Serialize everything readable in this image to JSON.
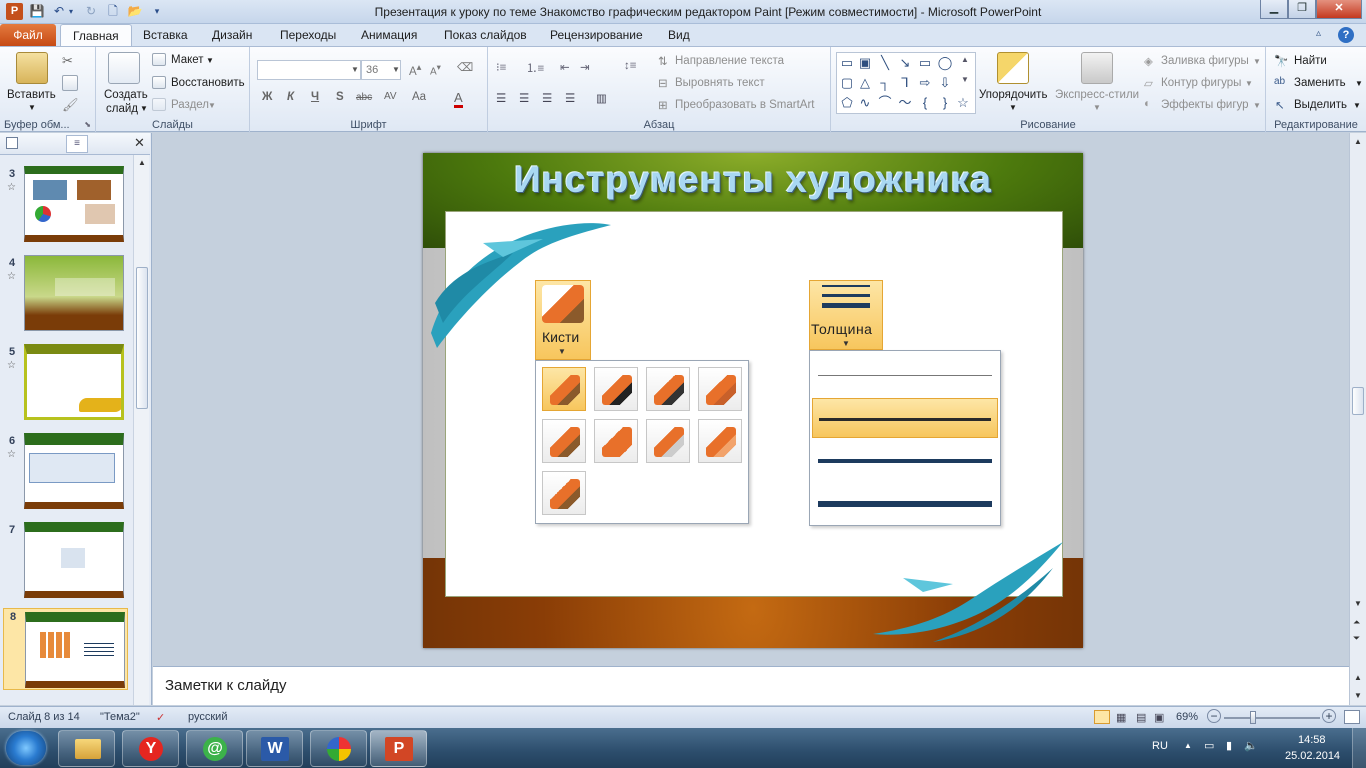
{
  "window": {
    "title": "Презентация к уроку по теме Знакомство графическим редактором Paint [Режим совместимости]  -  Microsoft PowerPoint"
  },
  "tabs": [
    "Файл",
    "Главная",
    "Вставка",
    "Дизайн",
    "Переходы",
    "Анимация",
    "Показ слайдов",
    "Рецензирование",
    "Вид"
  ],
  "ribbon": {
    "clipboard": {
      "paste": "Вставить",
      "label": "Буфер обм..."
    },
    "slides": {
      "new_slide_1": "Создать",
      "new_slide_2": "слайд",
      "layout": "Макет",
      "reset": "Восстановить",
      "section": "Раздел",
      "label": "Слайды"
    },
    "font": {
      "font_name": "",
      "font_size": "36",
      "label": "Шрифт",
      "bold": "Ж",
      "italic": "К",
      "underline": "Ч",
      "shadow": "S",
      "strike": "abc",
      "spacing": "AV",
      "case": "Aa",
      "color": "A"
    },
    "paragraph": {
      "text_direction": "Направление текста",
      "align_text": "Выровнять текст",
      "smartart": "Преобразовать в SmartArt",
      "label": "Абзац"
    },
    "drawing": {
      "arrange": "Упорядочить",
      "quick_styles": "Экспресс-стили",
      "fill": "Заливка фигуры",
      "outline": "Контур фигуры",
      "effects": "Эффекты фигур",
      "label": "Рисование"
    },
    "editing": {
      "find": "Найти",
      "replace": "Заменить",
      "select": "Выделить",
      "label": "Редактирование"
    }
  },
  "thumbnails": [
    {
      "num": "3",
      "star": "☆",
      "bg": "#2c6d1c"
    },
    {
      "num": "4",
      "star": "☆",
      "bg": "#6b9a1e"
    },
    {
      "num": "5",
      "star": "☆",
      "bg": "#7a8a12"
    },
    {
      "num": "6",
      "star": "☆",
      "bg": "#2c6d1c"
    },
    {
      "num": "7",
      "star": "",
      "bg": "#2c6d1c"
    },
    {
      "num": "8",
      "star": "",
      "bg": "#2c6d1c"
    }
  ],
  "slide": {
    "title": "Инструменты художника",
    "brushes_label": "Кисти",
    "thickness_label": "Толщина",
    "thickness_levels": [
      1,
      2,
      3,
      4
    ],
    "selected_thickness": 2,
    "brush_count": 9,
    "selected_brush": 1
  },
  "notes": {
    "placeholder": "Заметки к слайду"
  },
  "status": {
    "slide": "Слайд 8 из 14",
    "theme": "\"Тема2\"",
    "language": "русский",
    "zoom": "69%"
  },
  "taskbar": {
    "lang": "RU",
    "time": "14:58",
    "date": "25.02.2014"
  }
}
